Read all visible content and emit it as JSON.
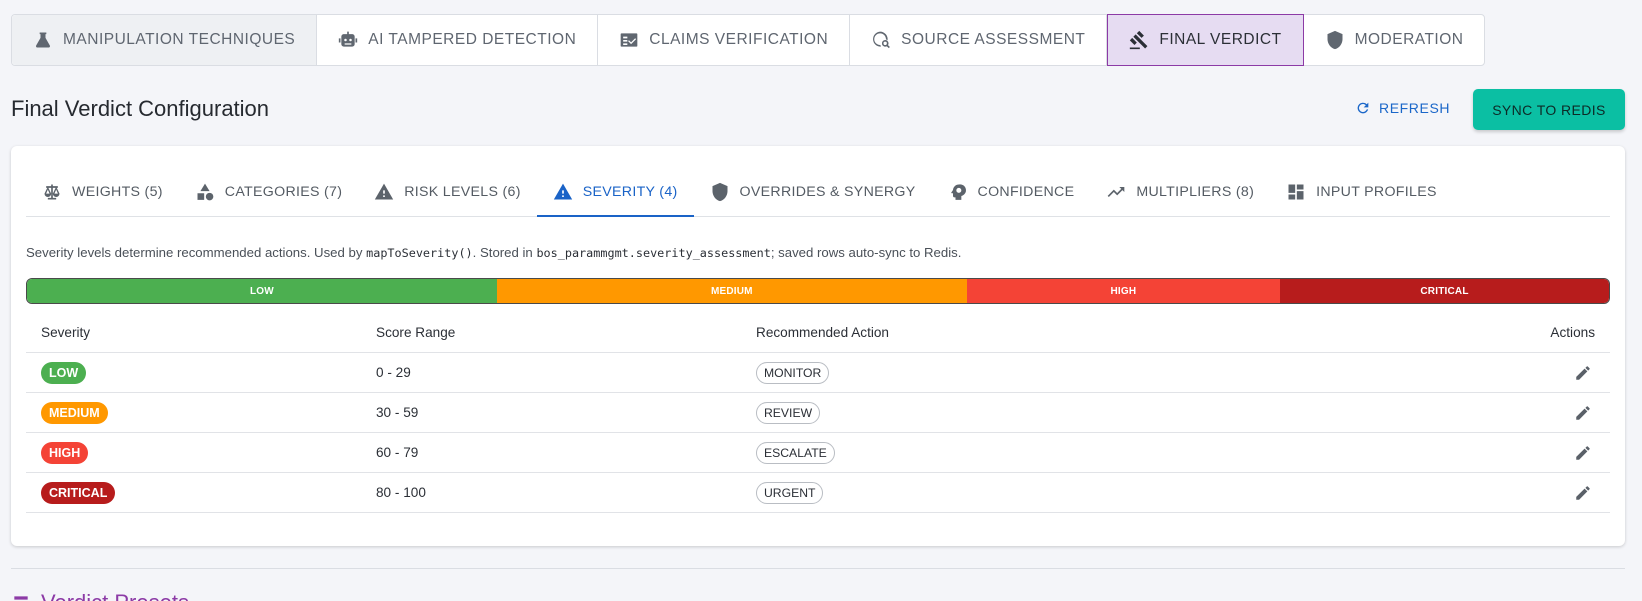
{
  "top_tabs": [
    {
      "label": "MANIPULATION TECHNIQUES",
      "icon": "flask-icon"
    },
    {
      "label": "AI TAMPERED DETECTION",
      "icon": "robot-icon"
    },
    {
      "label": "CLAIMS VERIFICATION",
      "icon": "fact-check-icon"
    },
    {
      "label": "SOURCE ASSESSMENT",
      "icon": "travel-explore-icon"
    },
    {
      "label": "FINAL VERDICT",
      "icon": "gavel-icon",
      "active": true
    },
    {
      "label": "MODERATION",
      "icon": "shield-icon"
    }
  ],
  "header": {
    "title": "Final Verdict Configuration",
    "refresh_label": "REFRESH",
    "sync_label": "SYNC TO REDIS"
  },
  "sub_tabs": [
    {
      "label": "WEIGHTS (5)",
      "icon": "scale-icon"
    },
    {
      "label": "CATEGORIES (7)",
      "icon": "category-icon"
    },
    {
      "label": "RISK LEVELS (6)",
      "icon": "warning-icon"
    },
    {
      "label": "SEVERITY (4)",
      "icon": "warning-icon",
      "active": true
    },
    {
      "label": "OVERRIDES & SYNERGY",
      "icon": "shield-icon"
    },
    {
      "label": "CONFIDENCE",
      "icon": "psychology-icon"
    },
    {
      "label": "MULTIPLIERS (8)",
      "icon": "trending-up-icon"
    },
    {
      "label": "INPUT PROFILES",
      "icon": "dashboard-icon"
    }
  ],
  "description": {
    "part1": "Severity levels determine recommended actions. Used by ",
    "code1": "mapToSeverity()",
    "part2": ". Stored in ",
    "code2": "bos_parammgmt.severity_assessment",
    "part3": "; saved rows auto-sync to Redis."
  },
  "severity_bar": [
    {
      "label": "LOW",
      "from": 0,
      "to": 29,
      "color": "#4caf50"
    },
    {
      "label": "MEDIUM",
      "from": 30,
      "to": 59,
      "color": "#ff9800"
    },
    {
      "label": "HIGH",
      "from": 60,
      "to": 79,
      "color": "#f44336"
    },
    {
      "label": "CRITICAL",
      "from": 80,
      "to": 100,
      "color": "#b71c1c"
    }
  ],
  "table": {
    "headers": {
      "severity": "Severity",
      "range": "Score Range",
      "action": "Recommended Action",
      "actions": "Actions"
    },
    "rows": [
      {
        "severity": "LOW",
        "color": "#4caf50",
        "range": "0 - 29",
        "action": "MONITOR"
      },
      {
        "severity": "MEDIUM",
        "color": "#ff9800",
        "range": "30 - 59",
        "action": "REVIEW"
      },
      {
        "severity": "HIGH",
        "color": "#f44336",
        "range": "60 - 79",
        "action": "ESCALATE"
      },
      {
        "severity": "CRITICAL",
        "color": "#b71c1c",
        "range": "80 - 100",
        "action": "URGENT"
      }
    ]
  },
  "next_section": {
    "title": "Verdict Presets"
  }
}
